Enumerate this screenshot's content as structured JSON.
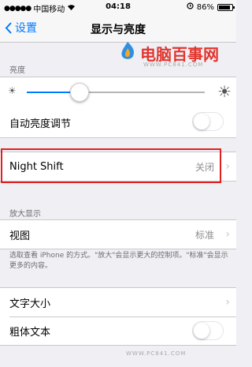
{
  "status_bar": {
    "carrier": "中国移动",
    "time": "04:18",
    "battery": "86%",
    "battery_level": 0.86
  },
  "nav": {
    "back_label": "设置",
    "title": "显示与亮度"
  },
  "watermark": {
    "name": "电脑百事网",
    "url": "WWW.PC841.COM"
  },
  "brightness": {
    "header": "亮度",
    "level": 0.3,
    "auto_label": "自动亮度调节",
    "auto_on": false
  },
  "night_shift": {
    "label": "Night Shift",
    "value": "关闭"
  },
  "zoom": {
    "header": "放大显示",
    "view_label": "视图",
    "view_value": "标准",
    "footer": "选取查看 iPhone 的方式。\"放大\"会显示更大的控制项。\"标准\"会显示更多的内容。"
  },
  "text": {
    "size_label": "文字大小",
    "bold_label": "粗体文本",
    "bold_on": false
  },
  "colors": {
    "accent": "#007aff",
    "highlight": "#e02020"
  }
}
